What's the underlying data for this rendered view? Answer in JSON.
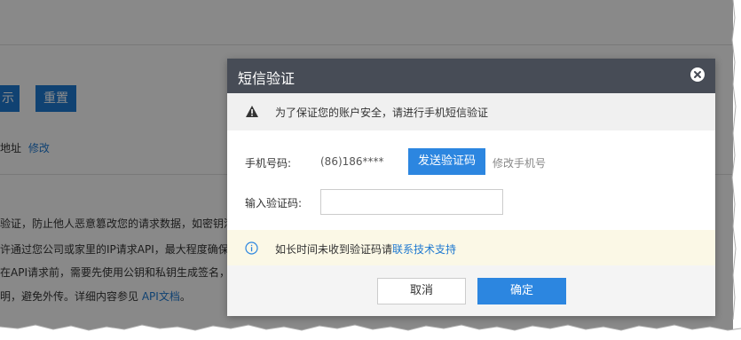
{
  "background": {
    "btn_left": "示",
    "btn_reset": "重置",
    "addr_label": "地址",
    "addr_modify": "修改",
    "lines": [
      "验证，防止他人恶意篡改您的请求数据，如密钥泄",
      "许通过您公司或家里的IP请求API，最大程度确保",
      "在API请求前，需要先使用公钥和私钥生成签名，"
    ],
    "last_line_prefix": "明，避免外传。详细内容参见 ",
    "last_line_link": "API文档",
    "last_line_suffix": "。"
  },
  "dialog": {
    "title": "短信验证",
    "warning": "为了保证您的账户安全，请进行手机短信验证",
    "phone_label": "手机号码:",
    "phone_value": "(86)186****",
    "send_button": "发送验证码",
    "modify_phone": "修改手机号",
    "code_label": "输入验证码:",
    "code_value": "",
    "code_placeholder": "",
    "info_text": "如长时间未收到验证码请",
    "info_link": "联系技术支持",
    "cancel_button": "取消",
    "ok_button": "确定"
  },
  "colors": {
    "primary": "#2c86e0",
    "header": "#474c56",
    "info_bg": "#fbf8e6"
  }
}
